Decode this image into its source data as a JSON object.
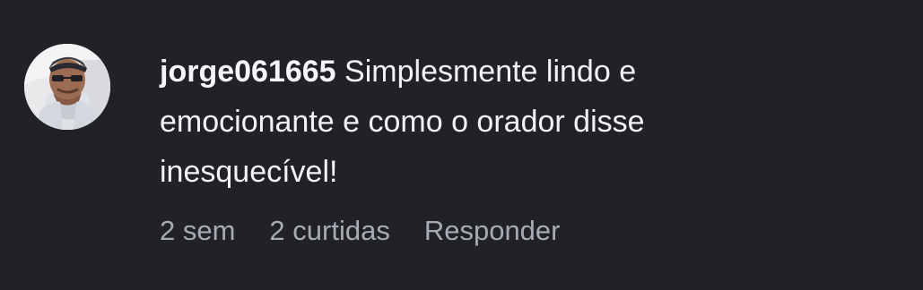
{
  "comment": {
    "author": "jorge061665",
    "text": "Simplesmente lindo e emocionante e como o orador disse inesquecível!",
    "avatar_icon": "user-avatar-photo",
    "meta": {
      "time": "2 sem",
      "likes": "2 curtidas",
      "reply_label": "Responder"
    }
  },
  "colors": {
    "background": "#212228",
    "text": "#f1f2f5",
    "secondary_text": "#a8abb3"
  }
}
